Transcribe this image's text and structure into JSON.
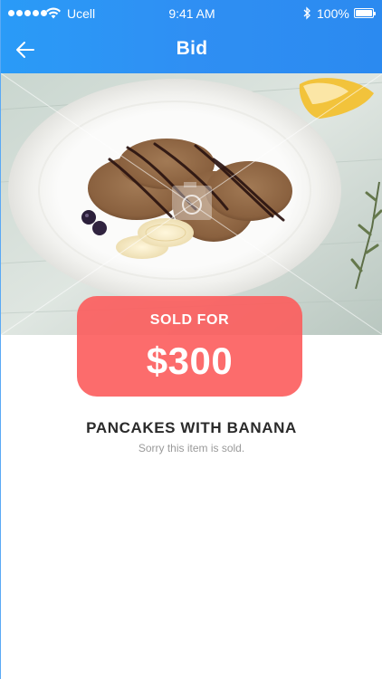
{
  "status_bar": {
    "carrier": "Ucell",
    "time": "9:41 AM",
    "battery": "100%",
    "battery_level": 1.0,
    "signal_bars": 5
  },
  "nav": {
    "title": "Bid",
    "back_icon": "arrow-left-icon"
  },
  "hero": {
    "placeholder_icon": "camera-icon"
  },
  "sold": {
    "label": "SOLD FOR",
    "price": "$300"
  },
  "item": {
    "title": "PANCAKES WITH BANANA",
    "subtitle": "Sorry this item is sold."
  },
  "colors": {
    "header": "#2f8ff3",
    "badge": "#fc5c5c",
    "title_text": "#2a2a2a",
    "subtitle_text": "#9a9a9a"
  }
}
